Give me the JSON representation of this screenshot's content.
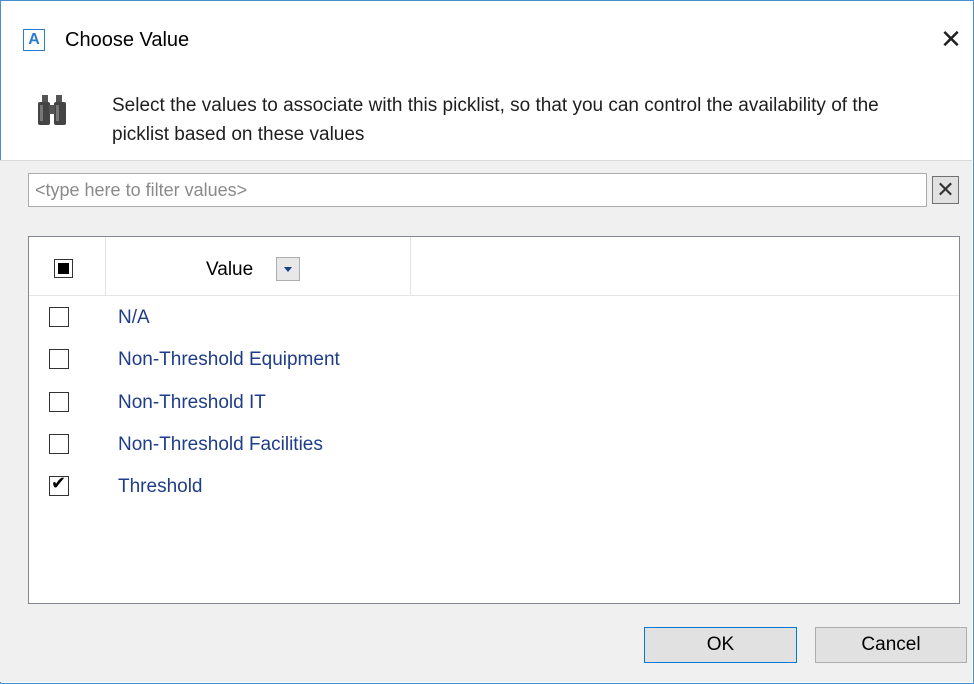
{
  "window": {
    "title": "Choose Value",
    "app_icon_glyph": "A",
    "close_glyph": "✕"
  },
  "header": {
    "description": "Select the values to associate with this picklist, so that you can control the availability of the picklist based on these values",
    "icon": "binoculars-icon"
  },
  "filter": {
    "placeholder": "<type here to filter values>",
    "value": "",
    "clear_glyph": "✕"
  },
  "grid": {
    "column_header": "Value",
    "select_all_state": "indeterminate",
    "rows": [
      {
        "label": "N/A",
        "checked": false
      },
      {
        "label": "Non-Threshold Equipment",
        "checked": false
      },
      {
        "label": "Non-Threshold IT",
        "checked": false
      },
      {
        "label": "Non-Threshold Facilities",
        "checked": false
      },
      {
        "label": "Threshold",
        "checked": true
      }
    ]
  },
  "buttons": {
    "ok_label": "OK",
    "cancel_label": "Cancel"
  },
  "colors": {
    "accent": "#0078d7",
    "row_text": "#1f3c88",
    "body_bg": "#f0f0f0"
  }
}
